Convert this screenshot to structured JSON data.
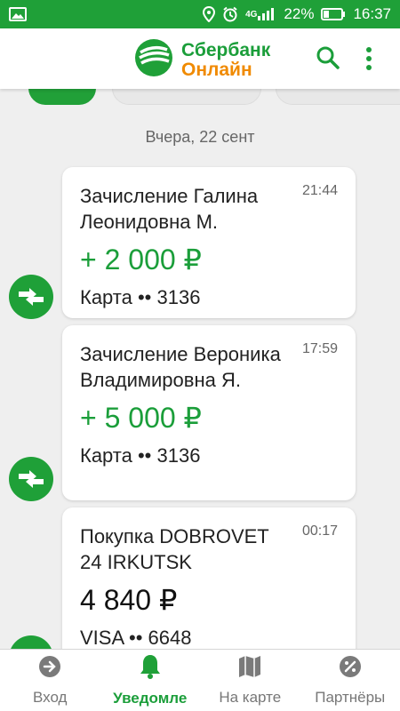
{
  "status_bar": {
    "network": "4G",
    "battery_percent": "22%",
    "time": "16:37"
  },
  "app": {
    "brand_line1": "Сбербанк",
    "brand_line2": "Онлайн",
    "colors": {
      "primary": "#1fa038",
      "accent": "#f08a00"
    }
  },
  "date_header": "Вчера, 22 сент",
  "items": [
    {
      "title": "Зачисление Галина Леонидовна М.",
      "time": "21:44",
      "amount": "+ 2 000 ₽",
      "account": "Карта •• 3136",
      "icon": "incoming-transfer-icon"
    },
    {
      "title": "Зачисление Вероника Владимировна Я.",
      "time": "17:59",
      "amount": "+ 5 000 ₽",
      "account": "Карта •• 3136",
      "icon": "incoming-transfer-icon"
    },
    {
      "title": "Покупка DOBROVET 24 IRKUTSK",
      "time": "00:17",
      "amount": "4 840 ₽",
      "account": "VISA •• 6648",
      "icon": "purchase-icon"
    }
  ],
  "bottom_nav": [
    {
      "label": "Вход",
      "icon": "login-icon"
    },
    {
      "label": "Уведомле",
      "icon": "bell-icon",
      "active": true
    },
    {
      "label": "На карте",
      "icon": "map-icon"
    },
    {
      "label": "Партнёры",
      "icon": "percent-icon"
    }
  ]
}
